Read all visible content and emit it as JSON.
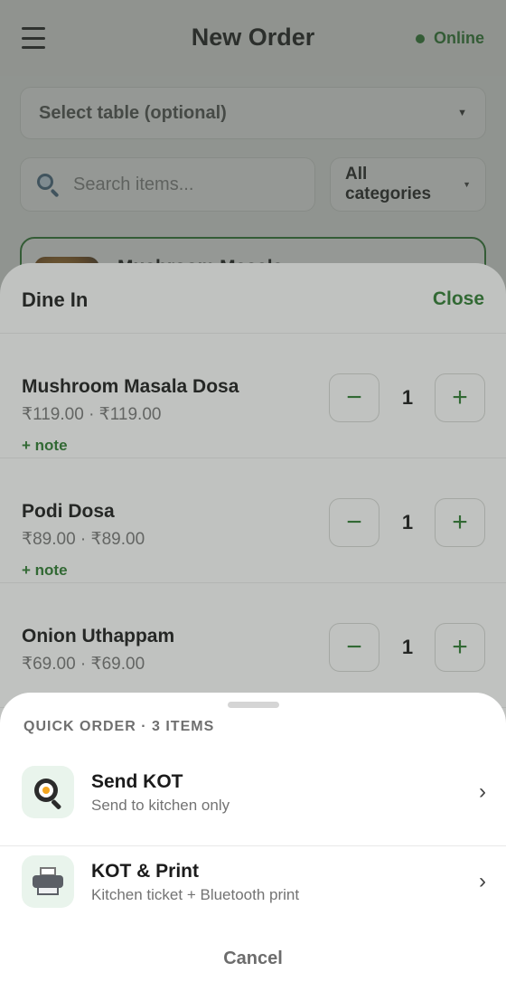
{
  "header": {
    "title": "New Order",
    "status": "Online"
  },
  "filters": {
    "table_select": "Select table (optional)",
    "search_placeholder": "Search items...",
    "category": "All categories"
  },
  "menu_list": {
    "first_item": "Mushroom Masala"
  },
  "cart": {
    "title": "Dine In",
    "close": "Close",
    "items": [
      {
        "name": "Mushroom Masala Dosa",
        "price": "₹119.00 · ₹119.00",
        "qty": "1",
        "note": "+ note"
      },
      {
        "name": "Podi Dosa",
        "price": "₹89.00 · ₹89.00",
        "qty": "1",
        "note": "+ note"
      },
      {
        "name": "Onion Uthappam",
        "price": "₹69.00 · ₹69.00",
        "qty": "1",
        "note": ""
      }
    ],
    "minus_symbol": "−",
    "plus_symbol": "+"
  },
  "quick_order": {
    "heading": "QUICK ORDER · 3 ITEMS",
    "options": [
      {
        "title": "Send KOT",
        "subtitle": "Send to kitchen only",
        "icon": "frying-pan-egg-icon"
      },
      {
        "title": "KOT & Print",
        "subtitle": "Kitchen ticket + Bluetooth print",
        "icon": "printer-icon"
      }
    ],
    "chevron": "›",
    "cancel": "Cancel"
  },
  "colors": {
    "accent": "#2e7d32",
    "overlay": "#3c423c",
    "icon_bg": "#e9f4ec"
  }
}
